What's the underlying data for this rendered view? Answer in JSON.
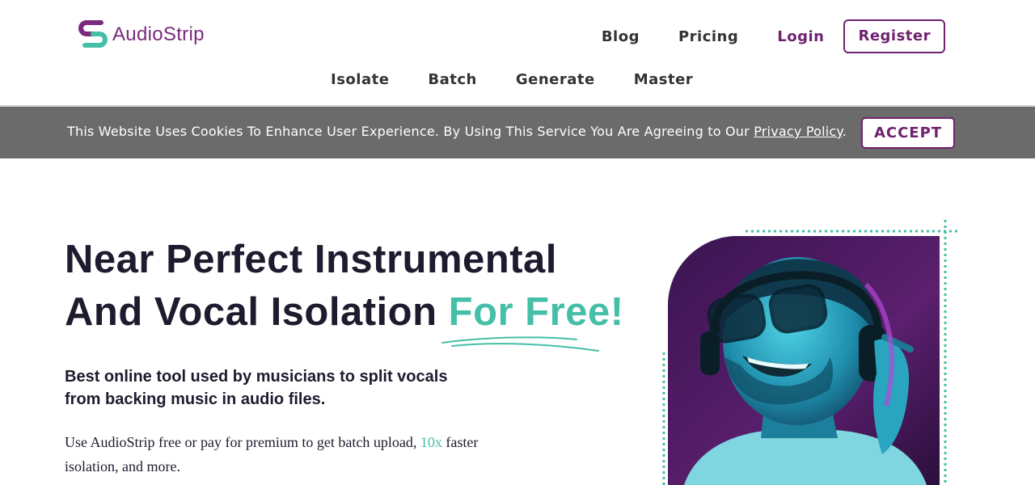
{
  "header": {
    "logo_text": "AudioStrip",
    "nav": {
      "blog": "Blog",
      "pricing": "Pricing",
      "login": "Login",
      "register": "Register"
    },
    "sub_nav": [
      "Isolate",
      "Batch",
      "Generate",
      "Master"
    ]
  },
  "cookie_bar": {
    "text": "This Website Uses Cookies To Enhance User Experience. By Using This Service You Are Agreeing to Our ",
    "link": "Privacy Policy",
    "period": ".",
    "accept": "ACCEPT"
  },
  "hero": {
    "title_line1": "Near Perfect Instrumental",
    "title_line2": "And Vocal Isolation ",
    "title_accent": "For Free!",
    "subtitle": "Best online tool used by musicians to split vocals from backing music in audio files.",
    "desc_before": "Use AudioStrip free or pay for premium to get batch upload, ",
    "desc_highlight": "10x",
    "desc_after": " faster isolation, and more."
  },
  "colors": {
    "brand_purple": "#6f236f",
    "accent_teal": "#45bfa7",
    "cookie_bg": "#6b6b6b",
    "heading": "#1e1b2e"
  }
}
